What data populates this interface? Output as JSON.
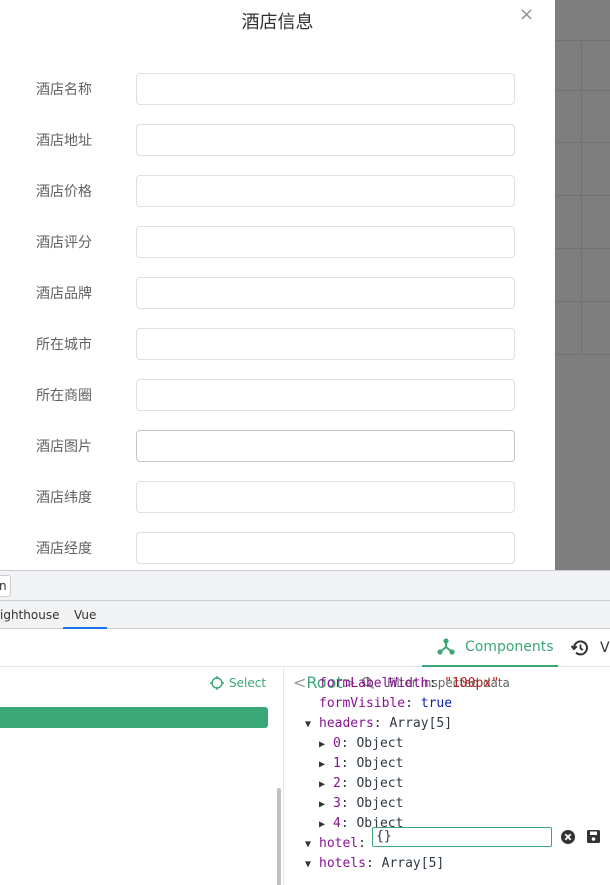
{
  "dialog": {
    "title": "酒店信息",
    "close_symbol": "×",
    "fields": [
      {
        "label": "酒店名称",
        "value": ""
      },
      {
        "label": "酒店地址",
        "value": ""
      },
      {
        "label": "酒店价格",
        "value": ""
      },
      {
        "label": "酒店评分",
        "value": ""
      },
      {
        "label": "酒店品牌",
        "value": ""
      },
      {
        "label": "所在城市",
        "value": ""
      },
      {
        "label": "所在商圈",
        "value": ""
      },
      {
        "label": "酒店图片",
        "value": ""
      },
      {
        "label": "酒店纬度",
        "value": ""
      },
      {
        "label": "酒店经度",
        "value": ""
      }
    ]
  },
  "devtools": {
    "partial_button": "n",
    "tabs": [
      "ighthouse",
      "Vue"
    ],
    "active_tab": "Vue"
  },
  "vue": {
    "nav": {
      "components": "Components",
      "timeline_partial": "V"
    },
    "select_label": "Select",
    "root_label": "Root",
    "filter_placeholder": "Filter inspected data",
    "state": {
      "row0": {
        "key": "formLabelWidth",
        "value": "\"100px\""
      },
      "row1": {
        "key": "formVisible",
        "value": "true"
      },
      "row2": {
        "key": "headers",
        "value": "Array[5]"
      },
      "row3": {
        "key": "0",
        "value": "Object"
      },
      "row4": {
        "key": "1",
        "value": "Object"
      },
      "row5": {
        "key": "2",
        "value": "Object"
      },
      "row6": {
        "key": "3",
        "value": "Object"
      },
      "row7": {
        "key": "4",
        "value": "Object"
      },
      "row8": {
        "key": "hotel",
        "value": "{}"
      },
      "row9": {
        "key": "hotels",
        "value": "Array[5]"
      }
    }
  },
  "colors": {
    "vue_green": "#3ba776",
    "chrome_blue": "#1a73e8"
  }
}
